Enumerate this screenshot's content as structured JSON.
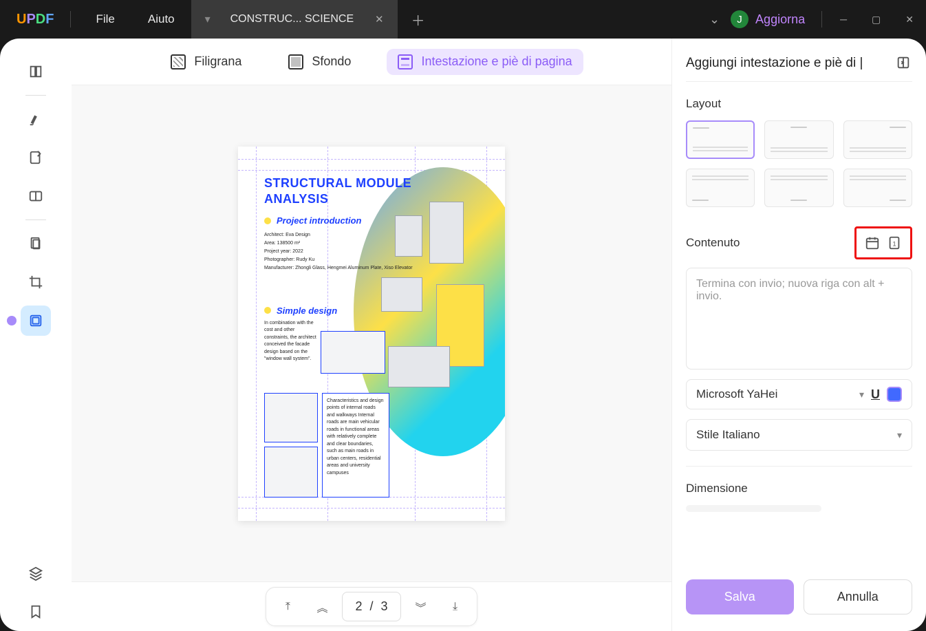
{
  "logo": {
    "l1": "U",
    "l2": "P",
    "l3": "D",
    "l4": "F"
  },
  "menu": {
    "file": "File",
    "help": "Aiuto"
  },
  "tab": {
    "title": "CONSTRUC... SCIENCE"
  },
  "user": {
    "initial": "J",
    "upgrade": "Aggiorna"
  },
  "toolbar": {
    "watermark": "Filigrana",
    "background": "Sfondo",
    "header_footer": "Intestazione e piè di pagina"
  },
  "document": {
    "title": "STRUCTURAL MODULE ANALYSIS",
    "sec1": "Project introduction",
    "meta": "Architect: Eva Design\nArea: 138500 m²\nProject year: 2022\nPhotographer: Rudy Ku\nManufacturer: Zhongli Glass, Hengmei Aluminum Plate, Xiso Elevator",
    "sec2": "Simple design",
    "para2": "In combination with the cost and other constraints, the architect conceived the facade design based on the \"window wall system\".",
    "box_text": "Characteristics and design points of internal roads and walkways Internal roads are main vehicular roads in functional areas with relatively complete and clear boundaries, such as main roads in urban centers, residential areas and university campuses"
  },
  "pagination": {
    "current": "2",
    "sep": "/",
    "total": "3"
  },
  "panel": {
    "title": "Aggiungi intestazione e piè di |",
    "layout_label": "Layout",
    "content_label": "Contenuto",
    "textarea_placeholder": "Termina con invio; nuova riga con alt + invio.",
    "font_name": "Microsoft YaHei",
    "style": "Stile Italiano",
    "dimension_label": "Dimensione",
    "save": "Salva",
    "cancel": "Annulla"
  }
}
